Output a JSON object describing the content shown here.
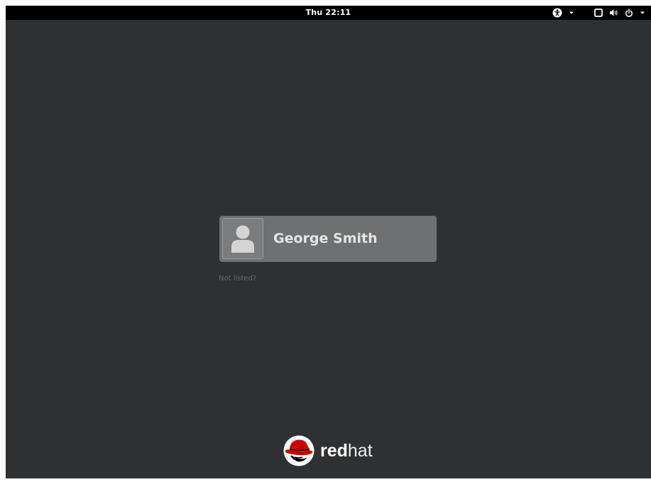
{
  "topbar": {
    "clock": "Thu 22:11",
    "icons": {
      "accessibility": "accessibility-icon",
      "accessibility_menu": "chevron-down-icon",
      "display": "display-icon",
      "volume": "volume-icon",
      "power": "power-icon",
      "system_menu": "chevron-down-icon"
    }
  },
  "login": {
    "user_name": "George Smith",
    "avatar_icon": "user-avatar-icon",
    "not_listed": "Not listed?"
  },
  "branding": {
    "logo_icon": "redhat-shadowman-logo",
    "word_bold": "red",
    "word_light": "hat"
  },
  "colors": {
    "background": "#2f3032",
    "topbar": "#000000",
    "user_card": "#6f7071",
    "logo_red": "#cc0000"
  }
}
